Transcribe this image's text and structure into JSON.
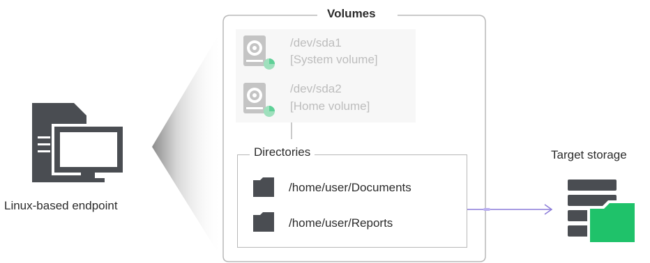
{
  "endpoint": {
    "label": "Linux-based endpoint"
  },
  "volumes": {
    "title": "Volumes",
    "items": [
      {
        "path": "/dev/sda1",
        "description": "[System volume]"
      },
      {
        "path": "/dev/sda2",
        "description": "[Home volume]"
      }
    ]
  },
  "directories": {
    "title": "Directories",
    "items": [
      {
        "path": "/home/user/Documents"
      },
      {
        "path": "/home/user/Reports"
      }
    ]
  },
  "target": {
    "label": "Target storage"
  },
  "colors": {
    "icon_dark": "#4a4d52",
    "accent_green": "#1fc26a",
    "disk_gray": "#c4c4c4",
    "arrow_purple": "#8a7ad8",
    "frame_gray": "#b8b8b8"
  }
}
